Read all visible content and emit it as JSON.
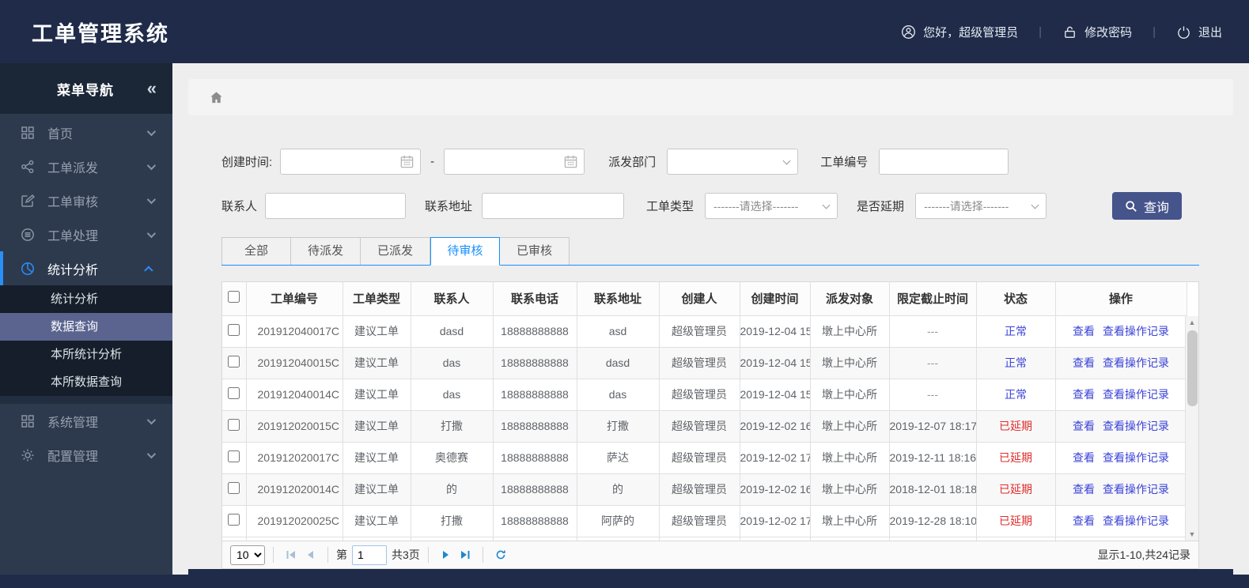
{
  "header": {
    "title": "工单管理系统",
    "greeting": "您好，超级管理员",
    "change_password": "修改密码",
    "logout": "退出"
  },
  "sidebar": {
    "title": "菜单导航",
    "collapse_icon": "«",
    "items": [
      {
        "label": "首页"
      },
      {
        "label": "工单派发"
      },
      {
        "label": "工单审核"
      },
      {
        "label": "工单处理"
      },
      {
        "label": "统计分析",
        "expanded": true,
        "children": [
          {
            "label": "统计分析"
          },
          {
            "label": "数据查询",
            "selected": true
          },
          {
            "label": "本所统计分析"
          },
          {
            "label": "本所数据查询"
          }
        ]
      },
      {
        "label": "系统管理"
      },
      {
        "label": "配置管理"
      }
    ]
  },
  "filters": {
    "created_time_label": "创建时间:",
    "date_from_value": "",
    "date_to_value": "",
    "range_separator": "-",
    "dispatch_dept_label": "派发部门",
    "dispatch_dept_value": "",
    "order_no_label": "工单编号",
    "order_no_value": "",
    "contact_label": "联系人",
    "contact_value": "",
    "address_label": "联系地址",
    "address_value": "",
    "order_type_label": "工单类型",
    "order_type_value": "-------请选择-------",
    "is_delayed_label": "是否延期",
    "is_delayed_value": "-------请选择-------",
    "search_button": "查询"
  },
  "tabs": [
    {
      "label": "全部"
    },
    {
      "label": "待派发"
    },
    {
      "label": "已派发"
    },
    {
      "label": "待审核",
      "active": true
    },
    {
      "label": "已审核"
    }
  ],
  "table": {
    "columns": [
      "工单编号",
      "工单类型",
      "联系人",
      "联系电话",
      "联系地址",
      "创建人",
      "创建时间",
      "派发对象",
      "限定截止时间",
      "状态",
      "操作"
    ],
    "op_labels": [
      "查看",
      "查看操作记录"
    ],
    "rows": [
      {
        "order_no": "201912040017C",
        "order_type": "建议工单",
        "contact": "dasd",
        "phone": "18888888888",
        "address": "asd",
        "creator": "超级管理员",
        "created": "2019-12-04 15",
        "target": "墩上中心所",
        "deadline": "---",
        "status": "正常",
        "status_type": "normal"
      },
      {
        "order_no": "201912040015C",
        "order_type": "建议工单",
        "contact": "das",
        "phone": "18888888888",
        "address": "dasd",
        "creator": "超级管理员",
        "created": "2019-12-04 15",
        "target": "墩上中心所",
        "deadline": "---",
        "status": "正常",
        "status_type": "normal"
      },
      {
        "order_no": "201912040014C",
        "order_type": "建议工单",
        "contact": "das",
        "phone": "18888888888",
        "address": "das",
        "creator": "超级管理员",
        "created": "2019-12-04 15",
        "target": "墩上中心所",
        "deadline": "---",
        "status": "正常",
        "status_type": "normal"
      },
      {
        "order_no": "201912020015C",
        "order_type": "建议工单",
        "contact": "打撒",
        "phone": "18888888888",
        "address": "打撒",
        "creator": "超级管理员",
        "created": "2019-12-02 16",
        "target": "墩上中心所",
        "deadline": "2019-12-07 18:17",
        "status": "已延期",
        "status_type": "delayed"
      },
      {
        "order_no": "201912020017C",
        "order_type": "建议工单",
        "contact": "奥德赛",
        "phone": "18888888888",
        "address": "萨达",
        "creator": "超级管理员",
        "created": "2019-12-02 17",
        "target": "墩上中心所",
        "deadline": "2019-12-11 18:16",
        "status": "已延期",
        "status_type": "delayed"
      },
      {
        "order_no": "201912020014C",
        "order_type": "建议工单",
        "contact": "的",
        "phone": "18888888888",
        "address": "的",
        "creator": "超级管理员",
        "created": "2019-12-02 16",
        "target": "墩上中心所",
        "deadline": "2018-12-01 18:18",
        "status": "已延期",
        "status_type": "delayed"
      },
      {
        "order_no": "201912020025C",
        "order_type": "建议工单",
        "contact": "打撒",
        "phone": "18888888888",
        "address": "阿萨的",
        "creator": "超级管理员",
        "created": "2019-12-02 17",
        "target": "墩上中心所",
        "deadline": "2019-12-28 18:10",
        "status": "已延期",
        "status_type": "delayed"
      }
    ],
    "partial_row_visible": true
  },
  "pagination": {
    "page_size": "10",
    "page_prefix": "第",
    "current_page": "1",
    "total_pages": "共3页",
    "summary": "显示1-10,共24记录"
  },
  "colors": {
    "navy": "#1f2b48",
    "accent_blue": "#1890ff",
    "sidebar_selected": "#5a648f",
    "button_indigo": "#46548c",
    "status_normal": "#3b43d8",
    "status_delayed": "#e02c2c"
  }
}
